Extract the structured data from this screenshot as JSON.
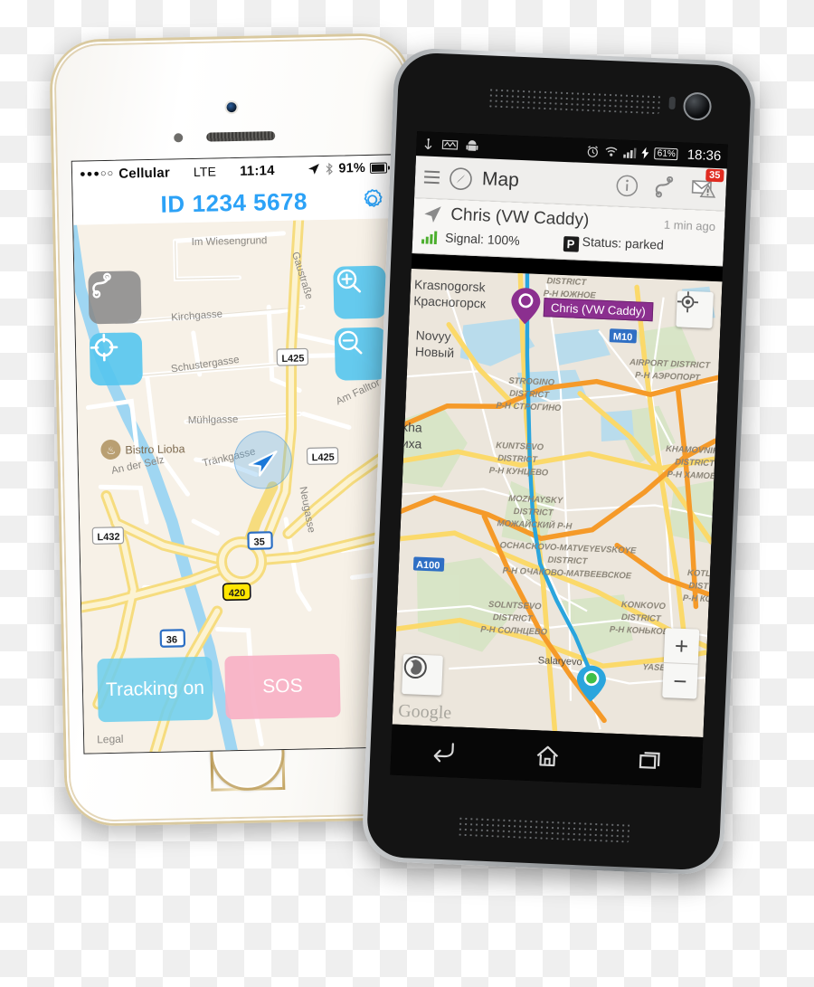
{
  "ios": {
    "status": {
      "signal_dots": "●●●○○",
      "carrier": "Cellular",
      "network": "LTE",
      "time": "11:14",
      "location_icon": "location-arrow-icon",
      "bluetooth_icon": "bluetooth-icon",
      "battery": "91%"
    },
    "header": {
      "id_label": "ID",
      "id_value": "1234 5678",
      "settings_icon": "gear-icon",
      "accent": "#2ca2f7"
    },
    "map_controls": {
      "track_icon": "route-track-icon",
      "locate_icon": "crosshair-locate-icon",
      "zoom_in_icon": "magnifier-plus-icon",
      "zoom_out_icon": "magnifier-minus-icon"
    },
    "map_labels": {
      "streets": [
        "Im Wiesengrund",
        "Gaustraße",
        "Kirchgasse",
        "Schustergasse",
        "Mühlgasse",
        "Am Falltor",
        "An der Selz",
        "Tränkgasse",
        "Neugasse"
      ],
      "poi": "Bistro Lioba",
      "shields": [
        "L425",
        "L425",
        "L432",
        "420",
        "35",
        "36"
      ]
    },
    "buttons": {
      "tracking": "Tracking on",
      "sos": "SOS",
      "tracking_color": "#6eceee",
      "sos_color": "#f7afc4"
    },
    "legal": "Legal"
  },
  "android": {
    "status": {
      "usb_icon": "usb-icon",
      "adb_icon": "debug-icon",
      "android_icon": "android-robot-icon",
      "alarm_icon": "alarm-clock-icon",
      "wifi_icon": "wifi-icon",
      "signal_icon": "signal-bars-icon",
      "charging_icon": "charging-bolt-icon",
      "battery": "61%",
      "time": "18:36"
    },
    "toolbar": {
      "menu_icon": "hamburger-menu-icon",
      "app_icon": "compass-icon",
      "title": "Map",
      "info_icon": "info-circle-icon",
      "track_icon": "route-track-icon",
      "mail_icon": "mail-warning-icon",
      "mail_badge": "35"
    },
    "info_panel": {
      "arrow_icon": "navigation-arrow-icon",
      "vehicle": "Chris (VW Caddy)",
      "updated": "1 min ago",
      "signal_icon": "signal-bars-icon",
      "signal": "Signal: 100%",
      "parking_icon": "parking-p-icon",
      "status": "Status: parked"
    },
    "map": {
      "vehicle_label": "Chris (VW Caddy)",
      "vehicle_label_color": "#8b2f8f",
      "my_location_icon": "my-location-icon",
      "layers_icon": "globe-layers-icon",
      "zoom_in": "+",
      "zoom_out": "−",
      "watermark": "Google",
      "cities": [
        {
          "lat_en": "Krasnogorsk",
          "lat_ru": "Красногорск"
        },
        {
          "lat_en": "Novyy",
          "lat_ru": "Новый"
        },
        {
          "lat_en": "rvikha",
          "lat_ru": "рвиха"
        }
      ],
      "districts": [
        "STROGINO DISTRICT",
        "Р-Н СТРОГИНО",
        "KUNTSEVO DISTRICT",
        "Р-Н КУНЦЕВО",
        "MOZHAYSKY DISTRICT",
        "МОЖАЙСКИЙ Р-Н",
        "OCHACKOVO-MATVEYEVSKOYE DISTRICT",
        "Р-Н ОЧАКОВО-МАТВЕЕВСКОЕ",
        "SOLNTSEVO DISTRICT",
        "Р-Н СОЛНЦЕВО",
        "KONKOVO DISTRICT",
        "Р-Н КОНЬКОВО",
        "AIRPORT DISTRICT",
        "Р-Н АЭРОПОРТ",
        "KHAMOVNIKI DISTRICT",
        "Р-Н ХАМОВНИ",
        "DISTRICT",
        "Р-Н ЮЖНОЕ",
        "KOTL DIST",
        "Р-Н КОТ",
        "YASENEVO"
      ],
      "places": [
        "Salaryevo"
      ],
      "shields": [
        "M10",
        "A100"
      ]
    },
    "nav": {
      "back_icon": "back-arrow-icon",
      "home_icon": "home-icon",
      "recents_icon": "recents-icon"
    }
  }
}
